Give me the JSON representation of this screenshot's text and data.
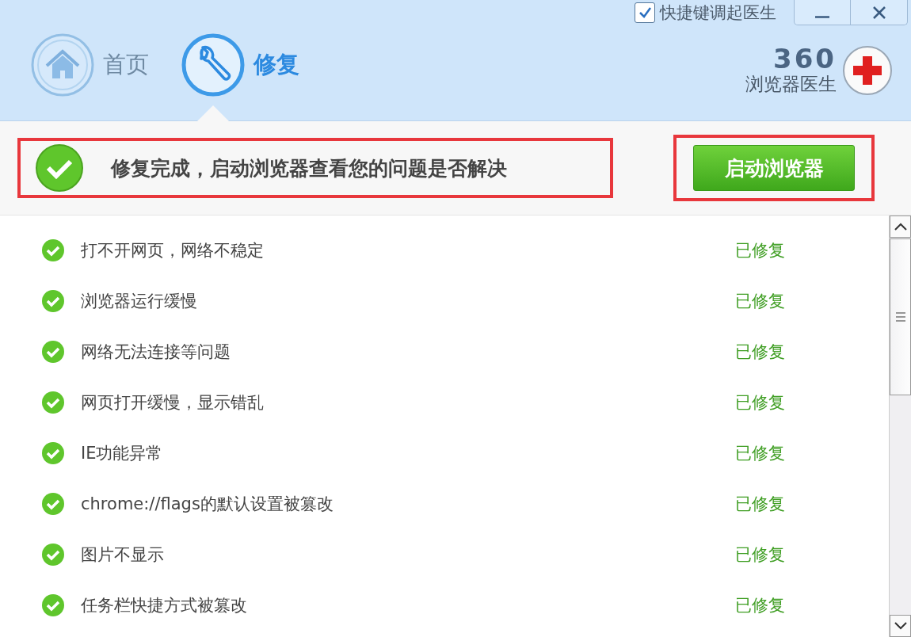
{
  "header": {
    "shortcut": {
      "label": "快捷键调起医生",
      "checked": true
    },
    "tabs": [
      {
        "label": "首页",
        "kind": "home",
        "selected": false
      },
      {
        "label": "修复",
        "kind": "repair",
        "selected": true
      }
    ],
    "logo": {
      "number": "360",
      "name": "浏览器医生"
    }
  },
  "banner": {
    "message": "修复完成，启动浏览器查看您的问题是否解决",
    "button": "启动浏览器"
  },
  "items": [
    {
      "label": "打不开网页，网络不稳定",
      "status": "已修复"
    },
    {
      "label": "浏览器运行缓慢",
      "status": "已修复"
    },
    {
      "label": "网络无法连接等问题",
      "status": "已修复"
    },
    {
      "label": "网页打开缓慢，显示错乱",
      "status": "已修复"
    },
    {
      "label": "IE功能异常",
      "status": "已修复"
    },
    {
      "label": "chrome://flags的默认设置被篡改",
      "status": "已修复"
    },
    {
      "label": "图片不显示",
      "status": "已修复"
    },
    {
      "label": "任务栏快捷方式被篡改",
      "status": "已修复"
    }
  ]
}
